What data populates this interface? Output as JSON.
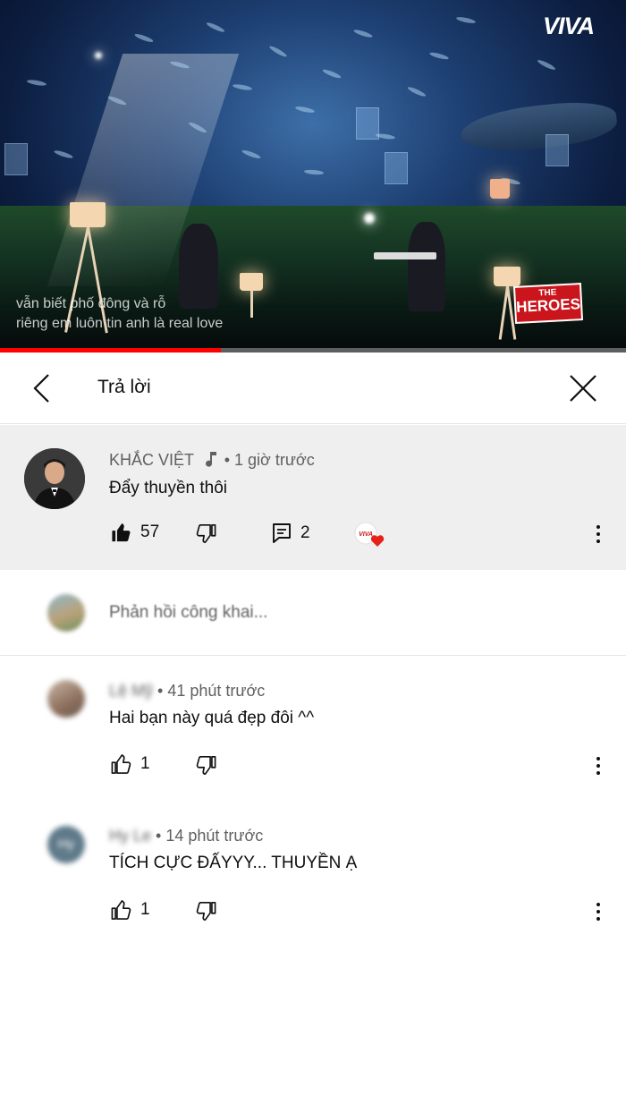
{
  "video": {
    "channel_logo": "VIVA",
    "caption_line_1": "vẫn biết phố đông và rỗ",
    "caption_line_2": "riêng em luôn tin anh là real love",
    "show_logo_small": "THE",
    "show_logo_main": "HEROES",
    "progress_fraction": 0.353,
    "colors": {
      "progress_played": "#ff0000"
    }
  },
  "header": {
    "title": "Trả lời",
    "back_icon": "chevron-left-icon",
    "close_icon": "close-icon"
  },
  "parent_comment": {
    "author": "KHẮC VIỆT",
    "music_icon": "music-note-icon",
    "time": "• 1 giờ trước",
    "text": "Đẩy thuyền thôi",
    "like_count": "57",
    "reply_count": "2",
    "heart_badge_text": "VIVA",
    "colors": {
      "heart": "#e62117",
      "background": "#efefef"
    }
  },
  "reply_box": {
    "placeholder": "Phản hồi công khai..."
  },
  "replies": [
    {
      "author": "Lệ Mỹ",
      "time": "• 41 phút trước",
      "text": "Hai bạn này quá đẹp đôi ^^",
      "like_count": "1"
    },
    {
      "author": "Hy Le",
      "avatar_initials": "Hy",
      "time": "• 14 phút trước",
      "text": "TÍCH CỰC ĐẤYYY... THUYỀN Ạ",
      "like_count": "1"
    }
  ]
}
